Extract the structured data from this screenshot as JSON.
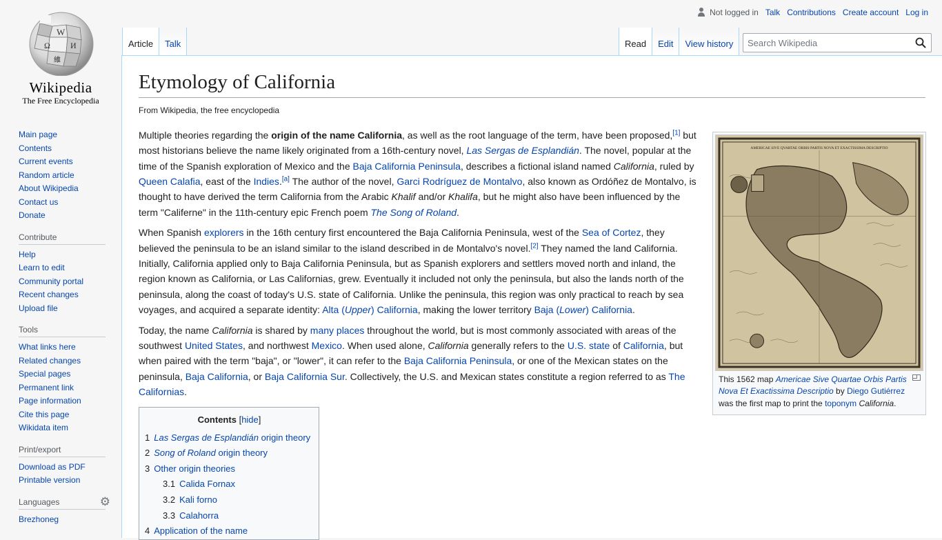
{
  "logo": {
    "wordmark": "Wikipedia",
    "tagline": "The Free Encyclopedia"
  },
  "sidebar": {
    "navigation": [
      "Main page",
      "Contents",
      "Current events",
      "Random article",
      "About Wikipedia",
      "Contact us",
      "Donate"
    ],
    "contribute": {
      "heading": "Contribute",
      "items": [
        "Help",
        "Learn to edit",
        "Community portal",
        "Recent changes",
        "Upload file"
      ]
    },
    "tools": {
      "heading": "Tools",
      "items": [
        "What links here",
        "Related changes",
        "Special pages",
        "Permanent link",
        "Page information",
        "Cite this page",
        "Wikidata item"
      ]
    },
    "print": {
      "heading": "Print/export",
      "items": [
        "Download as PDF",
        "Printable version"
      ]
    },
    "languages": {
      "heading": "Languages",
      "items": [
        "Brezhoneg"
      ]
    }
  },
  "personal": {
    "not_logged_in": "Not logged in",
    "talk": "Talk",
    "contributions": "Contributions",
    "create_account": "Create account",
    "login": "Log in"
  },
  "tabs": {
    "article": "Article",
    "talk": "Talk",
    "read": "Read",
    "edit": "Edit",
    "history": "View history"
  },
  "search": {
    "placeholder": "Search Wikipedia"
  },
  "page": {
    "title": "Etymology of California",
    "sitesub": "From Wikipedia, the free encyclopedia",
    "p1": {
      "t1": "Multiple theories regarding the ",
      "bold": "origin of the name California",
      "t2": ", as well as the root language of the term, have been proposed,",
      "ref1": "[1]",
      "t3": " but most historians believe the name likely originated from a 16th-century novel, ",
      "link_sergas": "Las Sergas de Esplandián",
      "t4": ". The novel, popular at the time of the Spanish exploration of Mexico and the ",
      "link_baja_pen": "Baja California Peninsula",
      "t5": ", describes a fictional island named ",
      "ital_california": "California",
      "t6": ", ruled by ",
      "link_calafia": "Queen Calafia",
      "t7": ", east of the ",
      "link_indies": "Indies",
      "ref_a": "[a]",
      "t8": " The author of the novel, ",
      "link_garci": "Garci Rodríguez de Montalvo",
      "t9": ", also known as Ordóñez de Montalvo, is thought to have derived the term California from the Arabic ",
      "ital_khalif": "Khalif",
      "t10": " and/or ",
      "ital_khalifa": "Khalifa",
      "t11": ", but he might also have been influenced by the term \"Califerne\" in the 11th-century epic French poem ",
      "link_roland": "The Song of Roland",
      "t12": "."
    },
    "p2": {
      "t1": "When Spanish ",
      "link_explorers": "explorers",
      "t2": " in the 16th century first encountered the Baja California Peninsula, west of the ",
      "link_cortez": "Sea of Cortez",
      "t3": ", they believed the peninsula to be an island similar to the island described in de Montalvo's novel.",
      "ref2": "[2]",
      "t4": " They named the land California. Initially, California applied only to Baja California Peninsula, but as Spanish explorers and settlers moved north and inland, the region known as California, or Las Californias, grew. Eventually it included not only the peninsula, but also the lands north of the peninsula, along the coast of today's U.S. state of California. Unlike the peninsula, this region was only practical to reach by sea voyages, and acquired a separate identity: ",
      "link_alta_a": "Alta (",
      "link_alta_i": "Upper",
      "link_alta_b": ") California",
      "t5": ", making the lower territory ",
      "link_baja_a": "Baja (",
      "link_baja_i": "Lower",
      "link_baja_b": ") California",
      "t6": "."
    },
    "p3": {
      "t1": "Today, the name ",
      "ital_california": "California",
      "t2": " is shared by ",
      "link_places": "many places",
      "t3": " throughout the world, but is most commonly associated with areas of the southwest ",
      "link_us": "United States",
      "t4": ", and northwest ",
      "link_mexico": "Mexico",
      "t5": ". When used alone, ",
      "ital_california2": "California",
      "t6": " generally refers to the ",
      "link_usstate": "U.S. state",
      "t7": " of ",
      "link_california": "California",
      "t8": ", but when paired with the term \"baja\", or \"lower\", it can refer to the ",
      "link_baja_pen": "Baja California Peninsula",
      "t9": ", or one of the Mexican states on the peninsula, ",
      "link_baja_cal": "Baja California",
      "t10": ", or ",
      "link_baja_sur": "Baja California Sur",
      "t11": ". Collectively, the U.S. and Mexican states constitute a region referred to as ",
      "link_californias": "The Californias",
      "t12": "."
    },
    "toc": {
      "title": "Contents",
      "hide_open": "[",
      "hide": "hide",
      "hide_close": "]",
      "items": [
        {
          "num": "1",
          "ital": "Las Sergas de Esplandián",
          "text": " origin theory"
        },
        {
          "num": "2",
          "ital": "Song of Roland",
          "text": " origin theory"
        },
        {
          "num": "3",
          "ital": "",
          "text": "Other origin theories"
        },
        {
          "num": "3.1",
          "ital": "",
          "text": "Calida Fornax"
        },
        {
          "num": "3.2",
          "ital": "",
          "text": "Kali forno"
        },
        {
          "num": "3.3",
          "ital": "",
          "text": "Calahorra"
        },
        {
          "num": "4",
          "ital": "",
          "text": "Application of the name"
        }
      ]
    },
    "infobox": {
      "map_title": "AMERICAE SIVE QVARTAE ORBIS PARTIS NOVA ET EXACTISSIMA DESCRIPTIO",
      "c1": "This 1562 map ",
      "c_link1": "Americae Sive Quartae Orbis Partis Nova Et Exactissima Descriptio",
      "c2": " by ",
      "c_link2": "Diego Gutiérrez",
      "c3": " was the first map to print the ",
      "c_link3": "toponym",
      "c4": " ",
      "c_ital": "California",
      "c5": "."
    }
  }
}
